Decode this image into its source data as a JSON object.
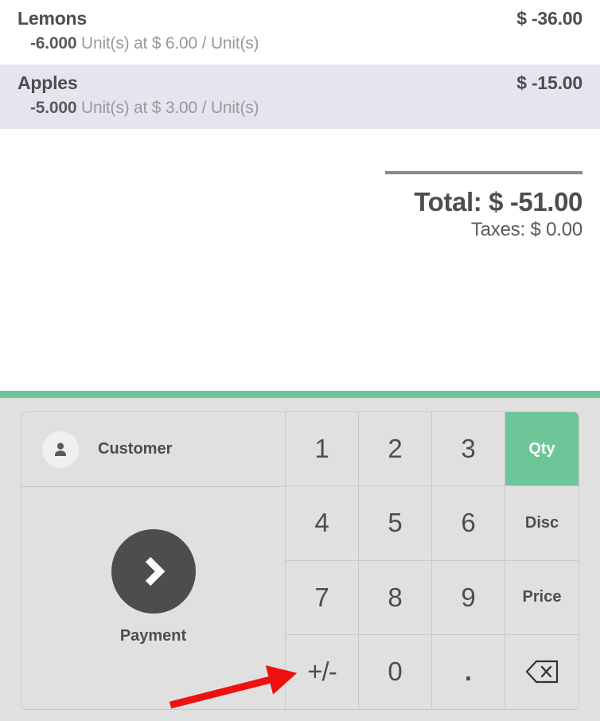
{
  "order_lines": [
    {
      "name": "Lemons",
      "price": "$ -36.00",
      "quantity": "-6.000",
      "detail": " Unit(s) at $ 6.00 / Unit(s)",
      "selected": false
    },
    {
      "name": "Apples",
      "price": "$ -15.00",
      "quantity": "-5.000",
      "detail": " Unit(s) at $ 3.00 / Unit(s)",
      "selected": true
    }
  ],
  "totals": {
    "total": "Total: $ -51.00",
    "taxes": "Taxes: $ 0.00"
  },
  "controls": {
    "customer_label": "Customer",
    "customer_icon": "person-icon",
    "payment_label": "Payment",
    "payment_icon": "chevron-right-icon"
  },
  "numpad": {
    "keys": [
      {
        "label": "1",
        "name": "numpad-key-1",
        "kind": "digit",
        "active": false
      },
      {
        "label": "2",
        "name": "numpad-key-2",
        "kind": "digit",
        "active": false
      },
      {
        "label": "3",
        "name": "numpad-key-3",
        "kind": "digit",
        "active": false
      },
      {
        "label": "Qty",
        "name": "numpad-mode-qty",
        "kind": "mode",
        "active": true
      },
      {
        "label": "4",
        "name": "numpad-key-4",
        "kind": "digit",
        "active": false
      },
      {
        "label": "5",
        "name": "numpad-key-5",
        "kind": "digit",
        "active": false
      },
      {
        "label": "6",
        "name": "numpad-key-6",
        "kind": "digit",
        "active": false
      },
      {
        "label": "Disc",
        "name": "numpad-mode-disc",
        "kind": "mode",
        "active": false
      },
      {
        "label": "7",
        "name": "numpad-key-7",
        "kind": "digit",
        "active": false
      },
      {
        "label": "8",
        "name": "numpad-key-8",
        "kind": "digit",
        "active": false
      },
      {
        "label": "9",
        "name": "numpad-key-9",
        "kind": "digit",
        "active": false
      },
      {
        "label": "Price",
        "name": "numpad-mode-price",
        "kind": "mode",
        "active": false
      },
      {
        "label": "+/-",
        "name": "numpad-key-sign",
        "kind": "sign",
        "active": false
      },
      {
        "label": "0",
        "name": "numpad-key-0",
        "kind": "digit",
        "active": false
      },
      {
        "label": ".",
        "name": "numpad-key-decimal",
        "kind": "dot",
        "active": false
      },
      {
        "label": "",
        "name": "numpad-key-backspace",
        "kind": "backspace",
        "active": false
      }
    ]
  },
  "annotation": {
    "type": "arrow",
    "color": "#ee1111",
    "points_to": "numpad-key-sign"
  },
  "colors": {
    "accent_green": "#6cc698",
    "selected_row": "#e5e5ef",
    "panel_background": "#e0e0e0",
    "text_primary": "#4d4d4d",
    "text_muted": "#9a9a9a",
    "dark_circle": "#4d4d4d"
  }
}
